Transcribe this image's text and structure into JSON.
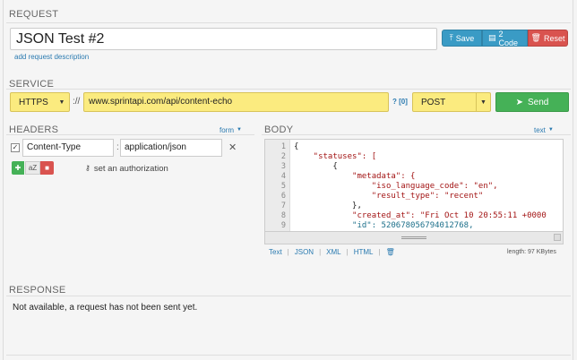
{
  "request": {
    "section_title": "REQUEST",
    "name_value": "JSON Test #2",
    "save_label": "Save",
    "code_label": "2 Code",
    "reset_label": "Reset",
    "add_description_link": "add request description"
  },
  "service": {
    "section_title": "SERVICE",
    "protocol": "HTTPS",
    "separator": "://",
    "url": "www.sprintapi.com/api/content-echo",
    "help": "? [0]",
    "method": "POST",
    "send_label": "Send"
  },
  "headers": {
    "section_title": "HEADERS",
    "mode_link": "form",
    "rows": [
      {
        "checked": true,
        "name": "Content-Type",
        "value": "application/json"
      }
    ],
    "sort_label": "aZ",
    "auth_link": "set an authorization"
  },
  "body": {
    "section_title": "BODY",
    "mode_link": "text",
    "lines": [
      "{",
      "    \"statuses\": [",
      "        {",
      "            \"metadata\": {",
      "                \"iso_language_code\": \"en\",",
      "                \"result_type\": \"recent\"",
      "            },",
      "            \"created_at\": \"Fri Oct 10 20:55:11 +0000",
      "            \"id\": 520678056794012768,"
    ],
    "format_links": [
      "Text",
      "JSON",
      "XML",
      "HTML"
    ],
    "length_label": "length: 97 KBytes"
  },
  "response": {
    "section_title": "RESPONSE",
    "message": "Not available, a request has not been sent yet."
  },
  "colors": {
    "accent_blue": "#3a9bc5",
    "danger_red": "#d9534f",
    "success_green": "#45b157",
    "highlight_yellow": "#fbeb7f"
  }
}
